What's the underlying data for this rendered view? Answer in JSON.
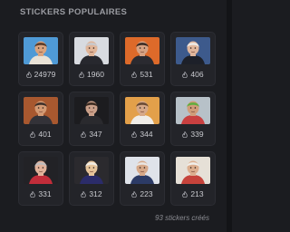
{
  "section": {
    "title": "STICKERS POPULAIRES"
  },
  "stickers": [
    {
      "count": "24979",
      "icon": "flame-icon",
      "bg": "#4f9ad6",
      "skin": "#d9a37e",
      "hair": "#5a3b28",
      "shirt": "#e9e2d6"
    },
    {
      "count": "1960",
      "icon": "flame-icon",
      "bg": "#d8dbe0",
      "skin": "#e0b598",
      "hair": "#c9c9cc",
      "shirt": "#27282e"
    },
    {
      "count": "531",
      "icon": "flame-icon",
      "bg": "#dd6a2a",
      "skin": "#d6a283",
      "hair": "#3a2a22",
      "shirt": "#2a2a30"
    },
    {
      "count": "406",
      "icon": "flame-icon",
      "bg": "#3d5a8c",
      "skin": "#e0b69c",
      "hair": "#ece9e6",
      "shirt": "#1d2029"
    },
    {
      "count": "401",
      "icon": "flame-icon",
      "bg": "#a8582f",
      "skin": "#d39a74",
      "hair": "#3c2e28",
      "shirt": "#333238"
    },
    {
      "count": "347",
      "icon": "flame-icon",
      "bg": "#1c1c1f",
      "skin": "#caa08a",
      "hair": "#3b2a20",
      "shirt": "#2a2a2e"
    },
    {
      "count": "344",
      "icon": "flame-icon",
      "bg": "#e3a04a",
      "skin": "#d6a888",
      "hair": "#6b4a33",
      "shirt": "#f0ede8"
    },
    {
      "count": "339",
      "icon": "flame-icon",
      "bg": "#b7c1c8",
      "skin": "#d09c78",
      "hair": "#5fae3e",
      "shirt": "#c94040"
    },
    {
      "count": "331",
      "icon": "flame-icon",
      "bg": "#222226",
      "skin": "#e2b29a",
      "hair": "#bfbcbd",
      "shirt": "#c22d3a"
    },
    {
      "count": "312",
      "icon": "flame-icon",
      "bg": "#2b2a2e",
      "skin": "#e6c49a",
      "hair": "#f0ece4",
      "shirt": "#2b2c6a"
    },
    {
      "count": "223",
      "icon": "flame-icon",
      "bg": "#dfe3ea",
      "skin": "#d6a888",
      "hair": "#e9e6e3",
      "shirt": "#2c3b66"
    },
    {
      "count": "213",
      "icon": "flame-icon",
      "bg": "#e6e0d7",
      "skin": "#dcae8e",
      "hair": "#f0efeb",
      "shirt": "#c6433b"
    }
  ],
  "footer": {
    "created": "93 stickers créés"
  }
}
